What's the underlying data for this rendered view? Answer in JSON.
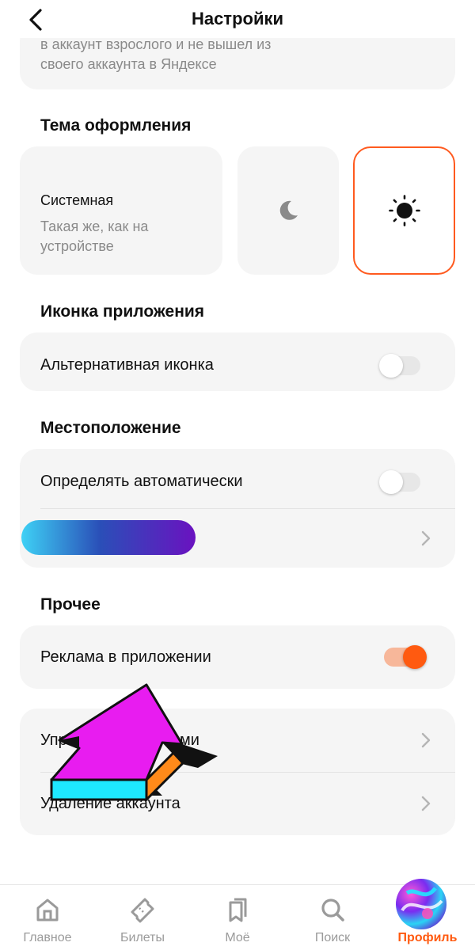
{
  "header": {
    "title": "Настройки"
  },
  "account_note": {
    "line1": "в аккаунт взрослого и не вышел из",
    "line2": "своего аккаунта в Яндексе"
  },
  "theme": {
    "title": "Тема оформления",
    "system_label": "Системная",
    "system_desc": "Такая же, как на устройстве",
    "selected": "light"
  },
  "app_icon": {
    "title": "Иконка приложения",
    "alt_icon_label": "Альтернативная иконка",
    "alt_icon_enabled": false
  },
  "location": {
    "title": "Местоположение",
    "auto_label": "Определять автоматически",
    "auto_enabled": false
  },
  "other": {
    "title": "Прочее",
    "ads_label": "Реклама в приложении",
    "ads_enabled": true,
    "manage_label": "Управление данными",
    "delete_label": "Удаление аккаунта"
  },
  "tabbar": {
    "items": [
      {
        "label": "Главное",
        "icon": "home-icon"
      },
      {
        "label": "Билеты",
        "icon": "ticket-icon"
      },
      {
        "label": "Моё",
        "icon": "bookmarks-icon"
      },
      {
        "label": "Поиск",
        "icon": "search-icon"
      },
      {
        "label": "Профиль",
        "icon": "avatar"
      }
    ],
    "active_index": 4
  },
  "colors": {
    "accent": "#ff5a10",
    "card": "#f5f5f5",
    "muted": "#8a8a8a"
  }
}
